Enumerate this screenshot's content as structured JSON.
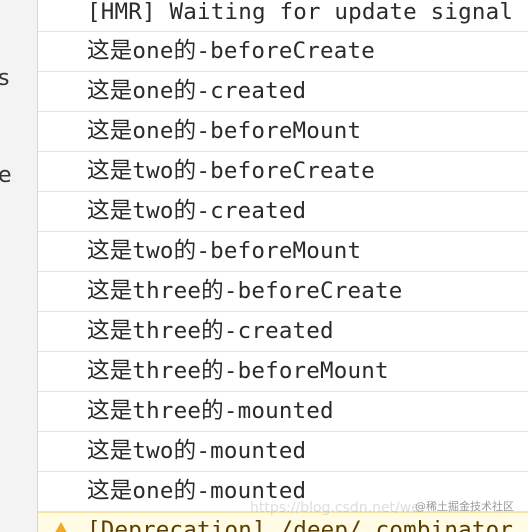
{
  "sidebar": {
    "fragments": [
      "s",
      "e"
    ]
  },
  "console": {
    "lines": [
      "[HMR] Waiting for update signal",
      "这是one的-beforeCreate",
      "这是one的-created",
      "这是one的-beforeMount",
      "这是two的-beforeCreate",
      "这是two的-created",
      "这是two的-beforeMount",
      "这是three的-beforeCreate",
      "这是three的-created",
      "这是three的-beforeMount",
      "这是three的-mounted",
      "这是two的-mounted",
      "这是one的-mounted"
    ],
    "warning": "[Deprecation] /deep/ combinator",
    "warning_icon": "warning-triangle-icon"
  },
  "watermark": {
    "url": "https://blog.csdn.net/we",
    "label": "@稀土掘金技术社区"
  }
}
